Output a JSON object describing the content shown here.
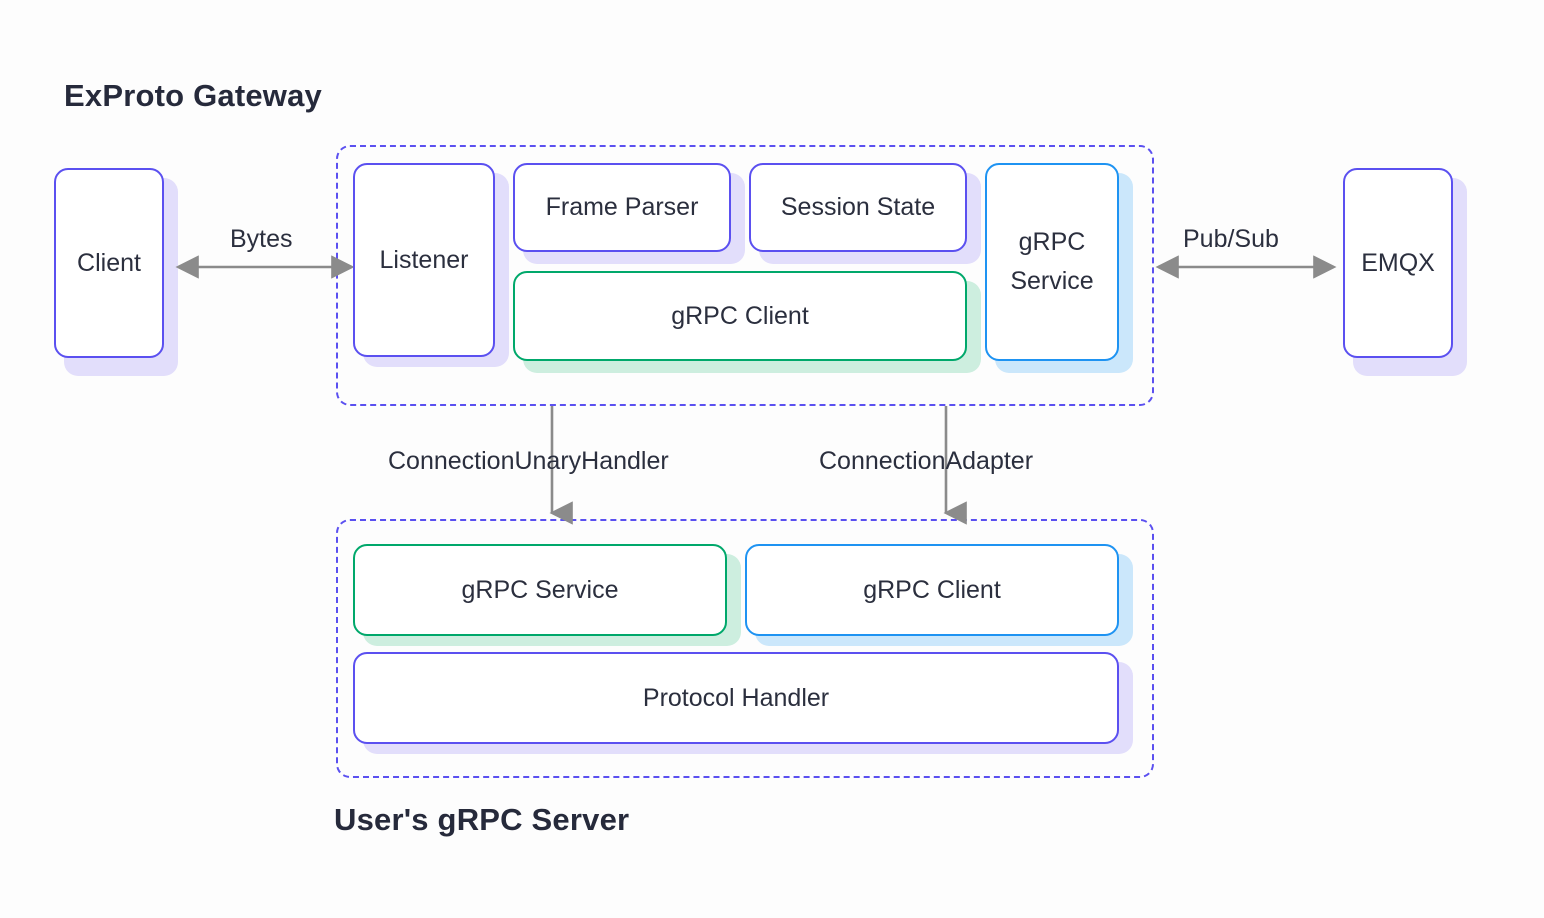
{
  "meta": {
    "background_color": "#fdfdfd",
    "text_color": "#2b2f3e"
  },
  "colors": {
    "purple": "#5b50f0",
    "purple_shadow": "#e2defb",
    "green": "#00a86b",
    "green_shadow": "#cdeedf",
    "blue": "#1e93f2",
    "blue_shadow": "#cbe7fb",
    "arrow_gray": "#8b8b8b",
    "dashed_border": "#5b50f0"
  },
  "titles": {
    "gateway": "ExProto Gateway",
    "server": "User's gRPC Server"
  },
  "external_nodes": [
    {
      "id": "client",
      "label": "Client",
      "color": "purple"
    },
    {
      "id": "emqx",
      "label": "EMQX",
      "color": "purple"
    }
  ],
  "gateway": {
    "title": "ExProto Gateway",
    "nodes": [
      {
        "id": "listener",
        "label": "Listener",
        "color": "purple"
      },
      {
        "id": "frame-parser",
        "label": "Frame Parser",
        "color": "purple"
      },
      {
        "id": "session-state",
        "label": "Session State",
        "color": "purple"
      },
      {
        "id": "grpc-client",
        "label": "gRPC Client",
        "color": "green"
      },
      {
        "id": "grpc-service",
        "label": "gRPC Service",
        "color": "blue"
      }
    ]
  },
  "server": {
    "title": "User's gRPC Server",
    "nodes": [
      {
        "id": "server-grpc-service",
        "label": "gRPC Service",
        "color": "green"
      },
      {
        "id": "server-grpc-client",
        "label": "gRPC Client",
        "color": "blue"
      },
      {
        "id": "server-protocol-handler",
        "label": "Protocol Handler",
        "color": "purple"
      }
    ]
  },
  "connections": [
    {
      "id": "bytes",
      "label": "Bytes",
      "direction": "bidirectional",
      "from": "client",
      "to": "listener"
    },
    {
      "id": "pubsub",
      "label": "Pub/Sub",
      "direction": "bidirectional",
      "from": "grpc-service",
      "to": "emqx"
    },
    {
      "id": "unary",
      "label": "ConnectionUnaryHandler",
      "direction": "down",
      "from": "gateway",
      "to": "server-grpc-service"
    },
    {
      "id": "adapter",
      "label": "ConnectionAdapter",
      "direction": "down",
      "from": "gateway",
      "to": "server-grpc-client"
    }
  ]
}
